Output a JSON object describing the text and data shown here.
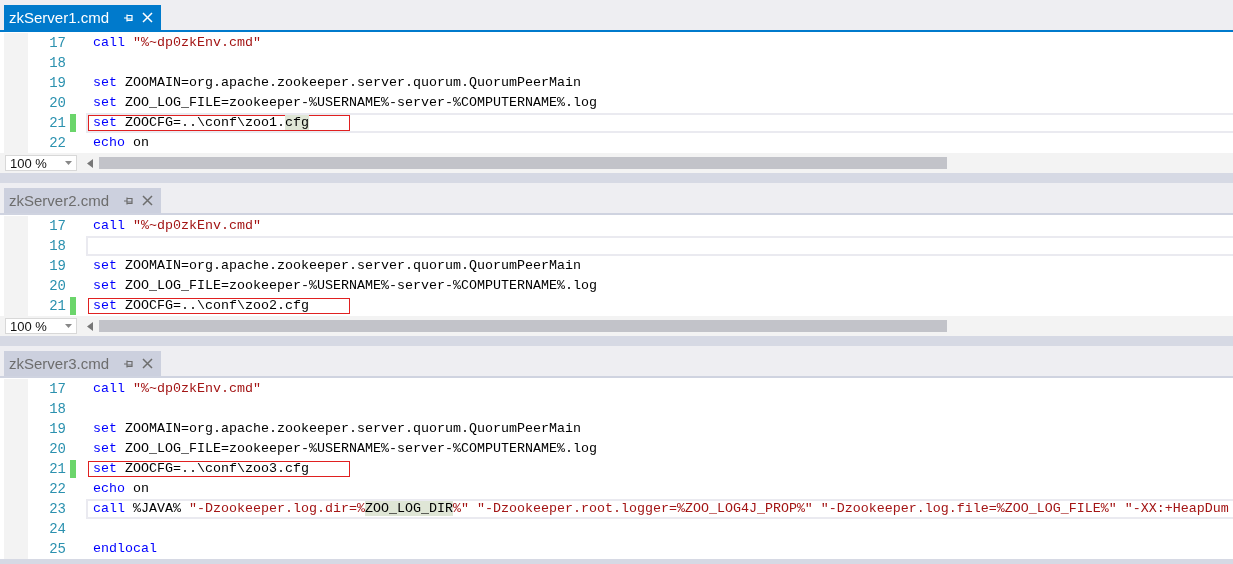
{
  "panes": [
    {
      "tab": {
        "title": "zkServer1.cmd",
        "selected": true
      },
      "zoom": "100 %",
      "lines": [
        {
          "number": "17",
          "tokens": [
            {
              "kind": "keyword",
              "text": "call"
            },
            {
              "kind": "string",
              "text": " \"%~dp0zkEnv.cmd\""
            }
          ],
          "changed": false,
          "boxed": false,
          "current": false
        },
        {
          "number": "18",
          "changed": false,
          "current": false
        },
        {
          "number": "19",
          "tokens": [
            {
              "kind": "keyword",
              "text": "set"
            },
            {
              "kind": "plain",
              "text": " ZOOMAIN=org.apache.zookeeper.server.quorum.QuorumPeerMain"
            }
          ],
          "changed": false,
          "boxed": false,
          "current": false
        },
        {
          "number": "20",
          "tokens": [
            {
              "kind": "keyword",
              "text": "set"
            },
            {
              "kind": "plain",
              "text": " ZOO_LOG_FILE=zookeeper-%USERNAME%-server-%COMPUTERNAME%.log"
            }
          ],
          "changed": false,
          "boxed": false,
          "current": false
        },
        {
          "number": "21",
          "tokens": [
            {
              "kind": "keyword",
              "text": "set"
            },
            {
              "kind": "plain",
              "text": " ZOOCFG=..\\conf\\zoo1."
            },
            {
              "kind": "highlight",
              "text": "cfg"
            }
          ],
          "changed": true,
          "boxed": true,
          "current": true
        },
        {
          "number": "22",
          "tokens": [
            {
              "kind": "keyword",
              "text": "echo"
            },
            {
              "kind": "plain",
              "text": " on"
            }
          ],
          "changed": false,
          "boxed": false,
          "current": false
        }
      ]
    },
    {
      "tab": {
        "title": "zkServer2.cmd",
        "selected": false
      },
      "zoom": "100 %",
      "lines": [
        {
          "number": "17",
          "tokens": [
            {
              "kind": "keyword",
              "text": "call"
            },
            {
              "kind": "string",
              "text": " \"%~dp0zkEnv.cmd\""
            }
          ],
          "changed": false,
          "boxed": false,
          "current": false
        },
        {
          "number": "18",
          "changed": false,
          "current": true
        },
        {
          "number": "19",
          "tokens": [
            {
              "kind": "keyword",
              "text": "set"
            },
            {
              "kind": "plain",
              "text": " ZOOMAIN=org.apache.zookeeper.server.quorum.QuorumPeerMain"
            }
          ],
          "changed": false,
          "boxed": false,
          "current": false
        },
        {
          "number": "20",
          "tokens": [
            {
              "kind": "keyword",
              "text": "set"
            },
            {
              "kind": "plain",
              "text": " ZOO_LOG_FILE=zookeeper-%USERNAME%-server-%COMPUTERNAME%.log"
            }
          ],
          "changed": false,
          "boxed": false,
          "current": false
        },
        {
          "number": "21",
          "tokens": [
            {
              "kind": "keyword",
              "text": "set"
            },
            {
              "kind": "plain",
              "text": " ZOOCFG=..\\conf\\zoo2.cfg"
            }
          ],
          "changed": true,
          "boxed": true,
          "current": false
        }
      ]
    },
    {
      "tab": {
        "title": "zkServer3.cmd",
        "selected": false
      },
      "lines": [
        {
          "number": "17",
          "tokens": [
            {
              "kind": "keyword",
              "text": "call"
            },
            {
              "kind": "string",
              "text": " \"%~dp0zkEnv.cmd\""
            }
          ],
          "changed": false,
          "boxed": false,
          "current": false
        },
        {
          "number": "18",
          "changed": false,
          "current": false
        },
        {
          "number": "19",
          "tokens": [
            {
              "kind": "keyword",
              "text": "set"
            },
            {
              "kind": "plain",
              "text": " ZOOMAIN=org.apache.zookeeper.server.quorum.QuorumPeerMain"
            }
          ],
          "changed": false,
          "boxed": false,
          "current": false
        },
        {
          "number": "20",
          "tokens": [
            {
              "kind": "keyword",
              "text": "set"
            },
            {
              "kind": "plain",
              "text": " ZOO_LOG_FILE=zookeeper-%USERNAME%-server-%COMPUTERNAME%.log"
            }
          ],
          "changed": false,
          "boxed": false,
          "current": false
        },
        {
          "number": "21",
          "tokens": [
            {
              "kind": "keyword",
              "text": "set"
            },
            {
              "kind": "plain",
              "text": " ZOOCFG=..\\conf\\zoo3.cfg"
            }
          ],
          "changed": true,
          "boxed": true,
          "current": false
        },
        {
          "number": "22",
          "tokens": [
            {
              "kind": "keyword",
              "text": "echo"
            },
            {
              "kind": "plain",
              "text": " on"
            }
          ],
          "changed": false,
          "boxed": false,
          "current": false
        },
        {
          "number": "23",
          "tokens": [
            {
              "kind": "keyword",
              "text": "call"
            },
            {
              "kind": "plain",
              "text": " %JAVA% "
            },
            {
              "kind": "string",
              "text": "\"-Dzookeeper.log.dir=%"
            },
            {
              "kind": "highlight",
              "text": "ZOO_LOG_DIR"
            },
            {
              "kind": "string",
              "text": "%\" \"-Dzookeeper.root.logger=%ZOO_LOG4J_PROP%\" \"-Dzookeeper.log.file=%ZOO_LOG_FILE%\" \"-XX:+HeapDum"
            }
          ],
          "changed": false,
          "boxed": false,
          "current": true
        },
        {
          "number": "24",
          "changed": false,
          "current": false
        },
        {
          "number": "25",
          "tokens": [
            {
              "kind": "keyword",
              "text": "endlocal"
            }
          ],
          "changed": false,
          "boxed": false,
          "current": false
        }
      ]
    }
  ]
}
